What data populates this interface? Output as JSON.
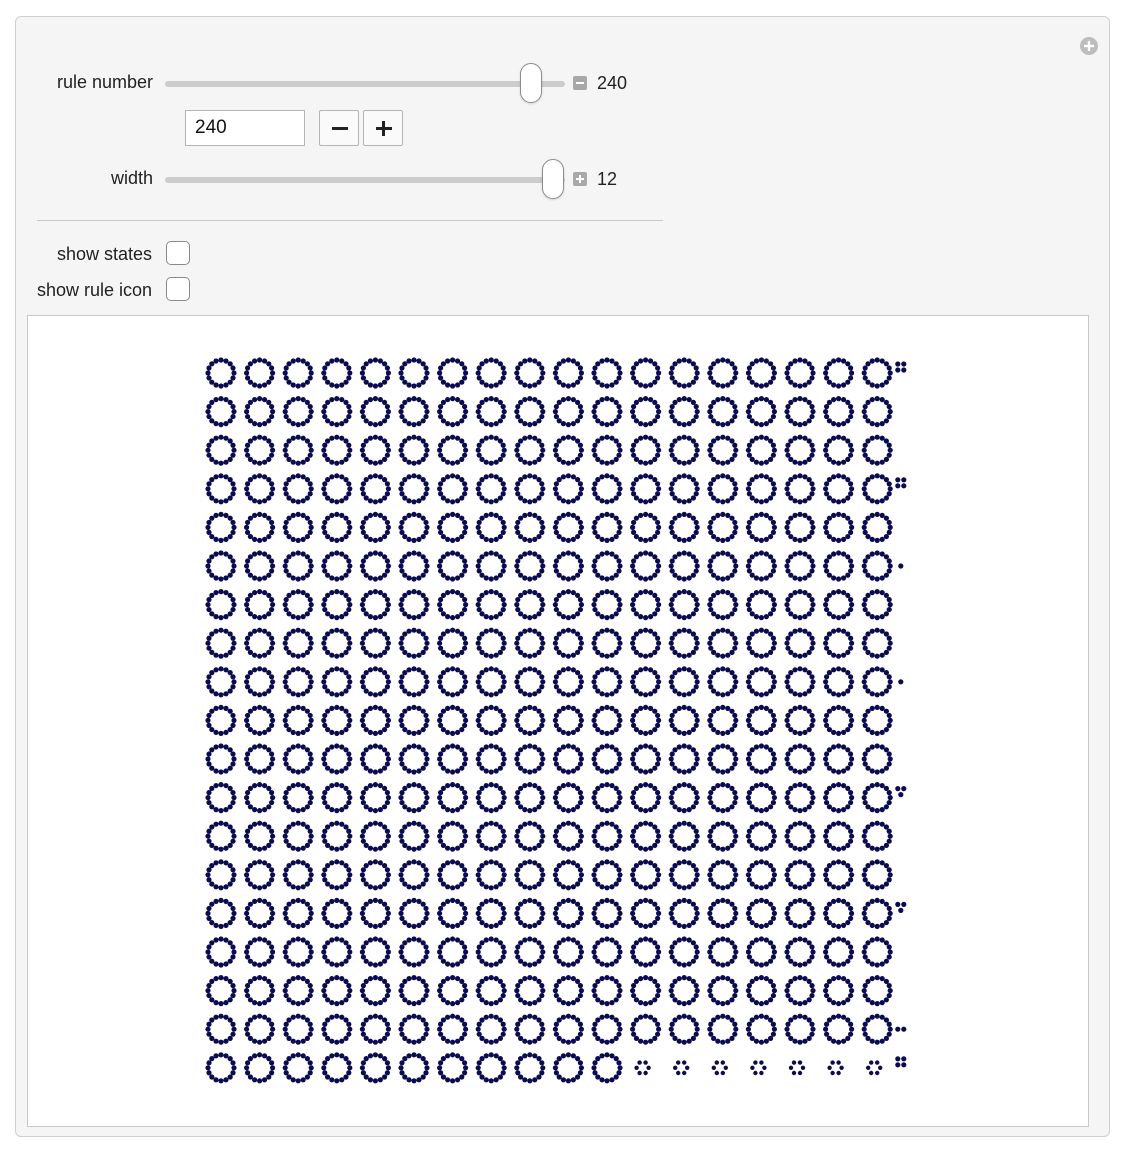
{
  "controls": {
    "rule_number": {
      "label": "rule number",
      "value": 240,
      "value_text": "240",
      "input_value": "240",
      "slider_position": 0.94,
      "expand_icon": "minus-icon"
    },
    "width": {
      "label": "width",
      "value": 12,
      "value_text": "12",
      "slider_position": 1.0,
      "expand_icon": "plus-icon"
    },
    "show_states": {
      "label": "show states",
      "checked": false
    },
    "show_rule_icon": {
      "label": "show rule icon",
      "checked": false
    }
  },
  "colors": {
    "dot": "#0b0b4f",
    "panel_background": "#f5f5f5",
    "output_background": "#ffffff"
  },
  "output": {
    "grid_rows": 19,
    "grid_columns": 18,
    "bottom_row_large_rings": 11,
    "bottom_row_small_rings": 7,
    "trailing_marks": [
      "4dot",
      "",
      "",
      "4dot",
      "",
      "1dot",
      "",
      "",
      "1dot",
      "",
      "",
      "3dot",
      "",
      "",
      "3dot",
      "",
      "",
      "2dot",
      "4dot"
    ]
  }
}
